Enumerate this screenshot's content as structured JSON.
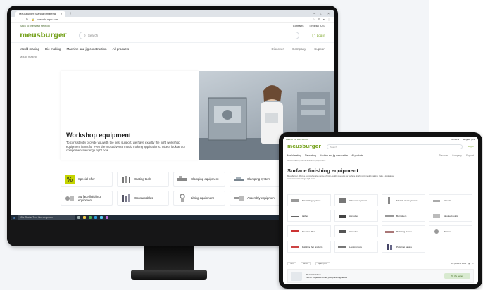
{
  "desktop": {
    "browser": {
      "tab_title": "Meusburger Standardmaterial",
      "url": "meusburger.com"
    },
    "topbar": {
      "back_link": "Back to the start section",
      "contact": "Contacts",
      "language": "English (US)"
    },
    "header": {
      "logo": "meusburger",
      "search_placeholder": "Search",
      "login": "Log in"
    },
    "nav": {
      "items": [
        "Mould making",
        "Die making",
        "Machine and jig construction",
        "All products"
      ],
      "right_items": [
        "Discover",
        "Company",
        "Support"
      ]
    },
    "breadcrumb": "Mould making",
    "hero": {
      "title": "Workshop equipment",
      "description": "To consistently provide you with the best support, we have exactly the right workshop equipment items for even the most diverse mould making applications. Take a look at our comprehensive range right now."
    },
    "categories": [
      "Special offer",
      "Cutting tools",
      "Clamping equipment",
      "Clamping system",
      "Surface finishing equipment",
      "Consumables",
      "Lifting equipment",
      "Assembly equipment"
    ],
    "taskbar_search": "Zur Suche Text hier eingeben"
  },
  "tablet": {
    "topbar": {
      "back_link": "Back to the start section",
      "contact": "Contacts",
      "language": "English (US)"
    },
    "header": {
      "logo": "meusburger",
      "search_placeholder": "Search",
      "login": "Log in"
    },
    "nav": {
      "items": [
        "Mould making",
        "Die making",
        "Machine and jig construction",
        "All products"
      ],
      "right_items": [
        "Discover",
        "Company",
        "Support"
      ]
    },
    "breadcrumb": "Mould making  /  Surface finishing equipment",
    "title": "Surface finishing equipment",
    "description": "Meusburger offers a comprehensive range of high-quality products for surface finishing in mould making. Take a look at our comprehensive range right now.",
    "categories": [
      "Structuring systems",
      "Ultrasonic systems",
      "Flexible shaft systems",
      "Air tools",
      "Lathes",
      "Abrasives",
      "Burnishers",
      "Mounted points",
      "Precision files",
      "Abrasives",
      "Polishing stones",
      "Brushes",
      "Polishing felt products",
      "Lapping tools",
      "Polishing pastes"
    ],
    "filter": {
      "sort": "Sort",
      "brand": "Brand",
      "spare_parts": "Spare parts",
      "count": "500 products found"
    },
    "product": {
      "name": "Detail Polishers",
      "line2": "Set of 10 pieces for all your polishing needs",
      "button": "To the series"
    }
  }
}
